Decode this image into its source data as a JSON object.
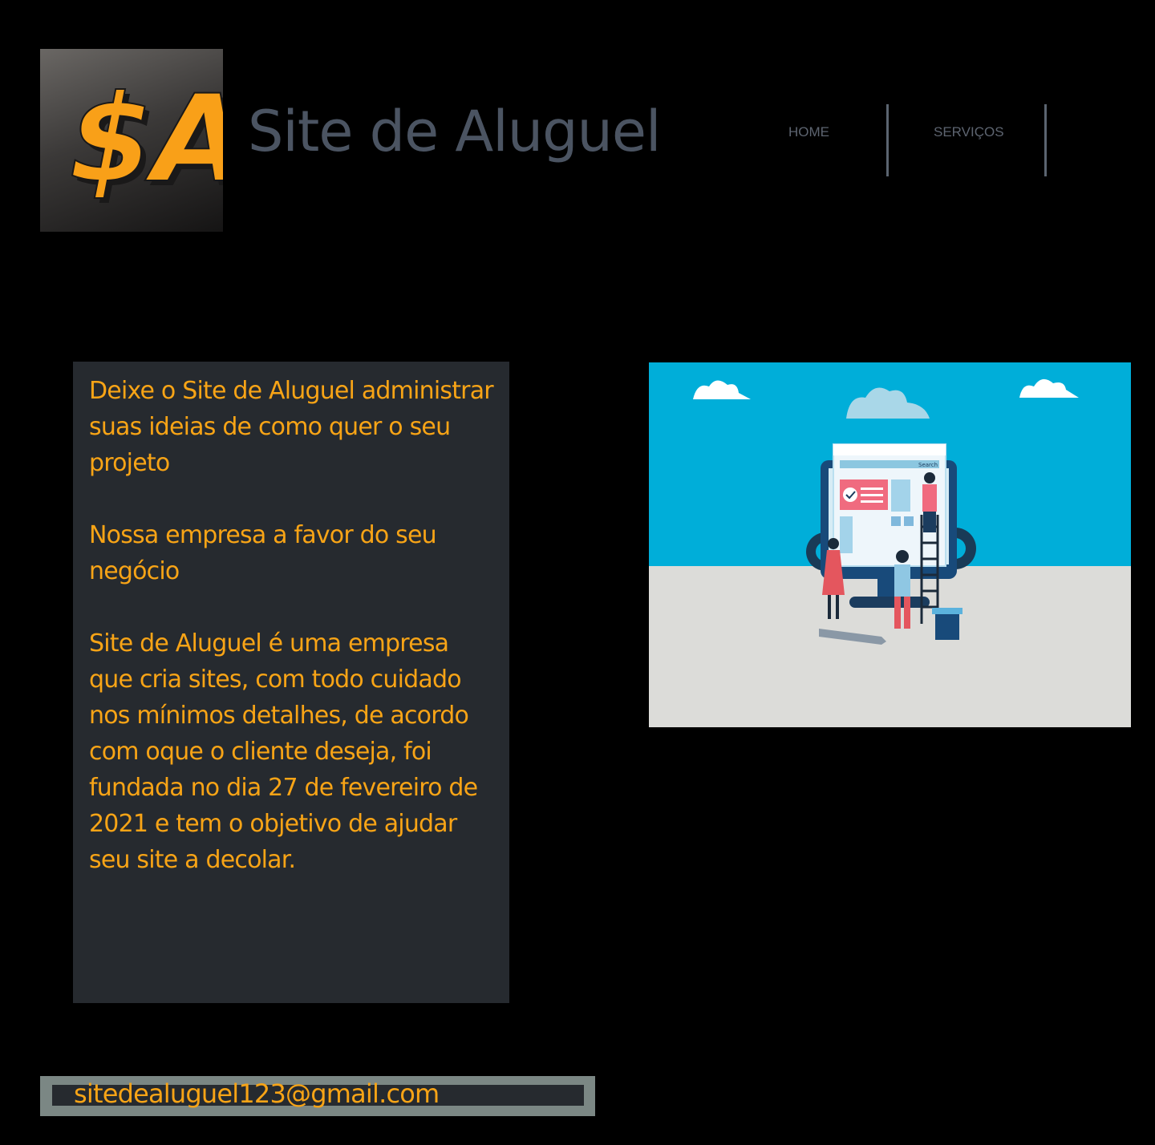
{
  "header": {
    "logo_text": "$A",
    "site_title": "Site de Aluguel",
    "nav": [
      {
        "label": "HOME"
      },
      {
        "label": "SERVIÇOS"
      }
    ]
  },
  "about": {
    "paragraphs": [
      "Deixe o Site de Aluguel administrar suas ideias de como quer o seu projeto",
      "Nossa empresa a favor do seu negócio",
      "Site de Aluguel é uma empresa que cria sites, com todo cuidado nos mínimos detalhes, de acordo com oque o cliente deseja, foi fundada no dia 27 de fevereiro de 2021 e tem o objetivo de ajudar seu site a decolar."
    ]
  },
  "illustration": {
    "search_label": "Search"
  },
  "footer": {
    "email": "sitedealuguel123@gmail.com"
  },
  "colors": {
    "background": "#000000",
    "accent": "#f8a416",
    "panel": "#262a2f",
    "title": "#4b5462",
    "sky": "#00aed9",
    "ground": "#dcdcd9"
  }
}
